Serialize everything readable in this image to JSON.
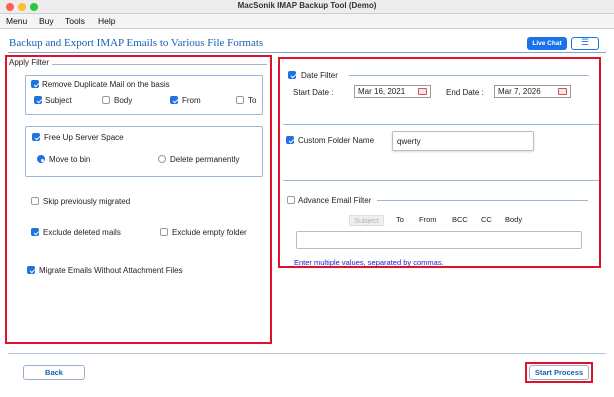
{
  "window": {
    "title": "MacSonik IMAP Backup Tool (Demo)"
  },
  "menu": [
    "Menu",
    "Buy",
    "Tools",
    "Help"
  ],
  "header": {
    "heading": "Backup and Export IMAP Emails to Various File Formats",
    "live_chat": "Live Chat",
    "menu_icon": "☰"
  },
  "apply_filter": {
    "legend": "Apply Filter",
    "remove_duplicate": {
      "label": "Remove Duplicate Mail on the basis",
      "checked": true
    },
    "duplicate_options": [
      {
        "label": "Subject",
        "checked": true
      },
      {
        "label": "Body",
        "checked": false
      },
      {
        "label": "From",
        "checked": true
      },
      {
        "label": "To",
        "checked": false
      }
    ],
    "free_up": {
      "label": "Free Up Server Space",
      "checked": true
    },
    "free_up_options": [
      {
        "label": "Move to bin",
        "selected": true
      },
      {
        "label": "Delete permanently",
        "selected": false
      }
    ],
    "skip_migrated": {
      "label": "Skip previously migrated",
      "checked": false
    },
    "exclude_deleted": {
      "label": "Exclude deleted mails",
      "checked": true
    },
    "exclude_empty": {
      "label": "Exclude empty folder",
      "checked": false
    },
    "without_attachment": {
      "label": "Migrate Emails Without Attachment Files",
      "checked": true
    }
  },
  "date_filter": {
    "label": "Date Filter",
    "checked": true,
    "start_label": "Start Date :",
    "start_value": "Mar 16, 2021",
    "end_label": "End Date :",
    "end_value": "Mar 7, 2026"
  },
  "custom_folder": {
    "label": "Custom Folder Name",
    "checked": true,
    "value": "qwerty"
  },
  "advance_filter": {
    "label": "Advance Email Filter",
    "checked": false,
    "fields": [
      "Subject",
      "To",
      "From",
      "BCC",
      "CC",
      "Body"
    ],
    "hint": "Enter multiple values, separated by commas."
  },
  "footer": {
    "back": "Back",
    "start": "Start Process"
  },
  "colors": {
    "accent": "#1a73e8",
    "highlight": "#e0112b",
    "link": "#1a5fb4"
  }
}
